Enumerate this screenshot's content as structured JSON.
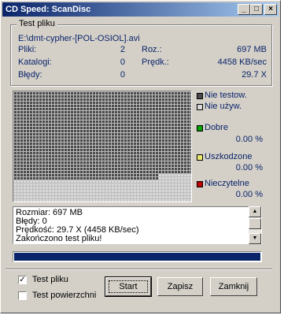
{
  "window": {
    "title": "CD Speed: ScanDisc",
    "controls": {
      "minimize": "_",
      "maximize": "□",
      "close": "×"
    }
  },
  "test_file": {
    "group_label": "Test pliku",
    "path": "E:\\dmt-cypher-[POL-OSIOL].avi",
    "files_label": "Pliki:",
    "files_value": "2",
    "dirs_label": "Katalogi:",
    "dirs_value": "0",
    "errors_label": "Błędy:",
    "errors_value": "0",
    "size_label": "Roz.:",
    "size_value": "697 MB",
    "speed_label": "Prędk.:",
    "speed_value": "4458 KB/sec",
    "multiplier_value": "29.7 X"
  },
  "legend": {
    "untested": {
      "label": "Nie testow.",
      "color": "#4a4a4a"
    },
    "unused": {
      "label": "Nie używ.",
      "color": "#d8d8d8"
    },
    "good": {
      "label": "Dobre",
      "pct": "0.00 %",
      "color": "#00a000"
    },
    "damaged": {
      "label": "Uszkodzone",
      "pct": "0.00 %",
      "color": "#e8e870"
    },
    "unreadable": {
      "label": "Nieczytelne",
      "pct": "0.00 %",
      "color": "#c00000"
    }
  },
  "log": {
    "lines": [
      "Rozmiar: 697 MB",
      "Błędy: 0",
      "Prędkość: 29.7 X (4458 KB/sec)",
      "Zakończono test pliku!"
    ]
  },
  "progress": {
    "fraction": 1.0,
    "color": "#0a246a"
  },
  "options": {
    "file_test_label": "Test pliku",
    "file_test_checked": true,
    "surface_test_label": "Test powierzchni",
    "surface_test_checked": false
  },
  "buttons": {
    "start": "Start",
    "save": "Zapisz",
    "close": "Zamknij"
  }
}
